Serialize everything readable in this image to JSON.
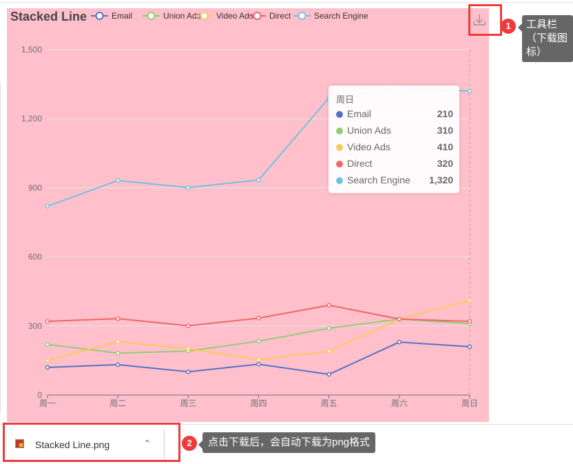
{
  "chart_data": {
    "type": "line",
    "title": "Stacked Line",
    "categories": [
      "周一",
      "周二",
      "周三",
      "周四",
      "周五",
      "周六",
      "周日"
    ],
    "ylim": [
      0,
      1500
    ],
    "yticks": [
      "0",
      "300",
      "600",
      "900",
      "1,200",
      "1,500"
    ],
    "grid": true,
    "legend_placement": "top",
    "series": [
      {
        "name": "Email",
        "color": "#5470c6",
        "values": [
          120,
          132,
          101,
          134,
          90,
          230,
          210
        ]
      },
      {
        "name": "Union Ads",
        "color": "#91cc75",
        "values": [
          220,
          182,
          191,
          234,
          290,
          330,
          310
        ]
      },
      {
        "name": "Video Ads",
        "color": "#fac858",
        "values": [
          150,
          232,
          201,
          154,
          190,
          330,
          410
        ]
      },
      {
        "name": "Direct",
        "color": "#ee6666",
        "values": [
          320,
          332,
          301,
          334,
          390,
          330,
          320
        ]
      },
      {
        "name": "Search Engine",
        "color": "#73c0de",
        "values": [
          820,
          932,
          901,
          934,
          1290,
          1330,
          1320
        ]
      }
    ]
  },
  "tooltip": {
    "title": "周日",
    "rows": [
      {
        "name": "Email",
        "value": "210",
        "color": "#5470c6"
      },
      {
        "name": "Union Ads",
        "value": "310",
        "color": "#91cc75"
      },
      {
        "name": "Video Ads",
        "value": "410",
        "color": "#fac858"
      },
      {
        "name": "Direct",
        "value": "320",
        "color": "#ee6666"
      },
      {
        "name": "Search Engine",
        "value": "1,320",
        "color": "#73c0de"
      }
    ]
  },
  "toolbox": {
    "icon": "download-icon"
  },
  "annotations": {
    "badge1": "1",
    "callout1": "工具栏（下载图标）",
    "badge2": "2",
    "callout2": "点击下载后，会自动下载为png格式"
  },
  "download": {
    "filename": "Stacked Line.png",
    "icon": "image-file-icon"
  }
}
